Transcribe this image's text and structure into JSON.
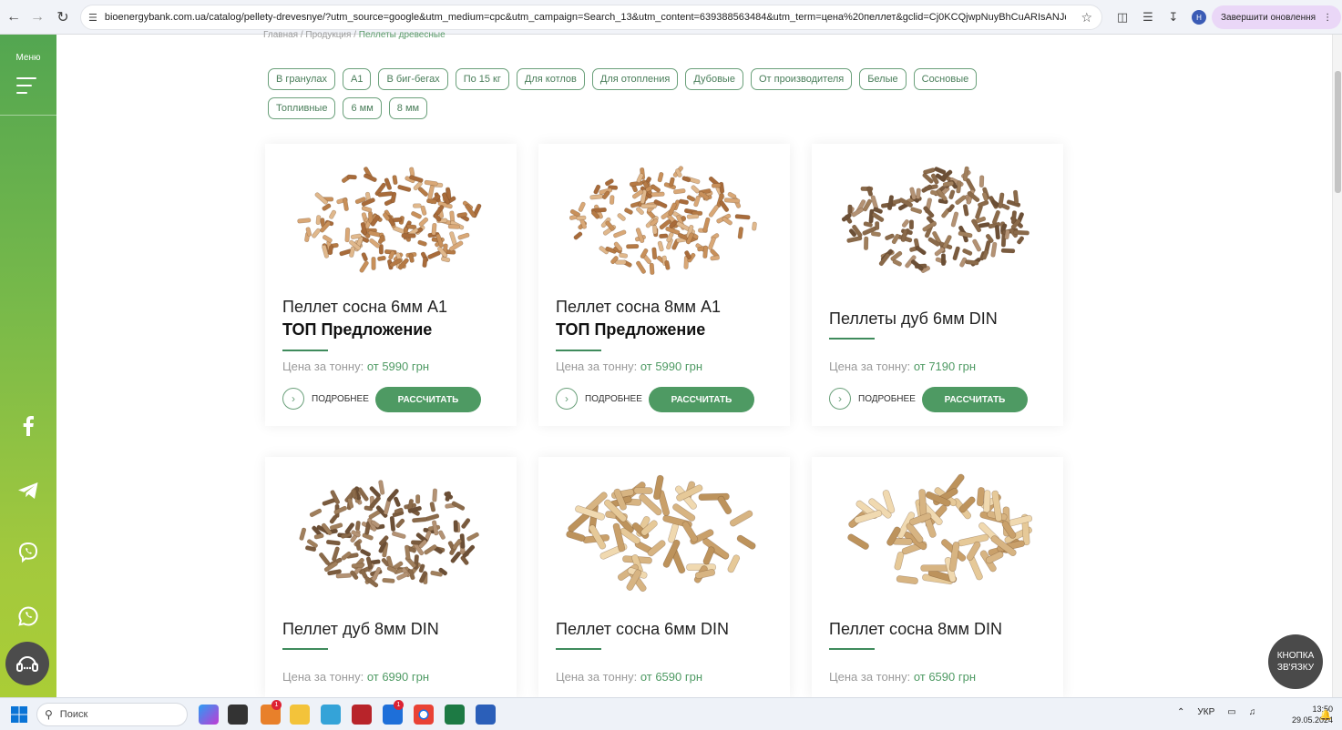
{
  "browser": {
    "url": "bioenergybank.com.ua/catalog/pellety-drevesnye/?utm_source=google&utm_medium=cpc&utm_campaign=Search_13&utm_content=639388563484&utm_term=цена%20пеллет&gclid=Cj0KCQjwpNuyBhCuARIsANJqL9P...",
    "avatar_letter": "H",
    "update_label": "Завершити оновлення"
  },
  "rail": {
    "menu_label": "Меню",
    "social_icons": [
      "facebook-icon",
      "telegram-icon",
      "viber-icon",
      "whatsapp-icon"
    ]
  },
  "breadcrumb": {
    "home": "Главная",
    "sep1": "/",
    "products": "Продукция",
    "sep2": "/",
    "current": "Пеллеты древесные"
  },
  "filters": [
    "В гранулах",
    "A1",
    "В биг-бегах",
    "По 15 кг",
    "Для котлов",
    "Для отопления",
    "Дубовые",
    "От производителя",
    "Белые",
    "Сосновые",
    "Топливные",
    "6 мм",
    "8 мм"
  ],
  "products": [
    {
      "title": "Пеллет сосна 6мм А1",
      "subtitle": "ТОП Предложение",
      "price_label": "Цена за тонну:",
      "price_value": "от 5990 грн",
      "more_label": "ПОДРОБНЕЕ",
      "calc_label": "РАССЧИТАТЬ"
    },
    {
      "title": "Пеллет сосна 8мм А1",
      "subtitle": "ТОП Предложение",
      "price_label": "Цена за тонну:",
      "price_value": "от 5990 грн",
      "more_label": "ПОДРОБНЕЕ",
      "calc_label": "РАССЧИТАТЬ"
    },
    {
      "title": "Пеллеты дуб 6мм DIN",
      "subtitle": "",
      "price_label": "Цена за тонну:",
      "price_value": "от 7190 грн",
      "more_label": "ПОДРОБНЕЕ",
      "calc_label": "РАССЧИТАТЬ"
    },
    {
      "title": "Пеллет дуб 8мм DIN",
      "subtitle": "",
      "price_label": "Цена за тонну:",
      "price_value": "от 6990 грн"
    },
    {
      "title": "Пеллет сосна 6мм DIN",
      "subtitle": "",
      "price_label": "Цена за тонну:",
      "price_value": "от 6590 грн"
    },
    {
      "title": "Пеллет сосна 8мм DIN",
      "subtitle": "",
      "price_label": "Цена за тонну:",
      "price_value": "от 6590 грн"
    }
  ],
  "contact_button": "КНОПКА ЗВ'ЯЗКУ",
  "taskbar": {
    "search_placeholder": "Поиск",
    "lang": "УКР",
    "time": "13:50",
    "date": "29.05.2024",
    "badge1": "1",
    "badge2": "1"
  },
  "colors": {
    "accent": "#4e9a63",
    "rail_top": "#53a651",
    "rail_bottom": "#aacd36"
  }
}
